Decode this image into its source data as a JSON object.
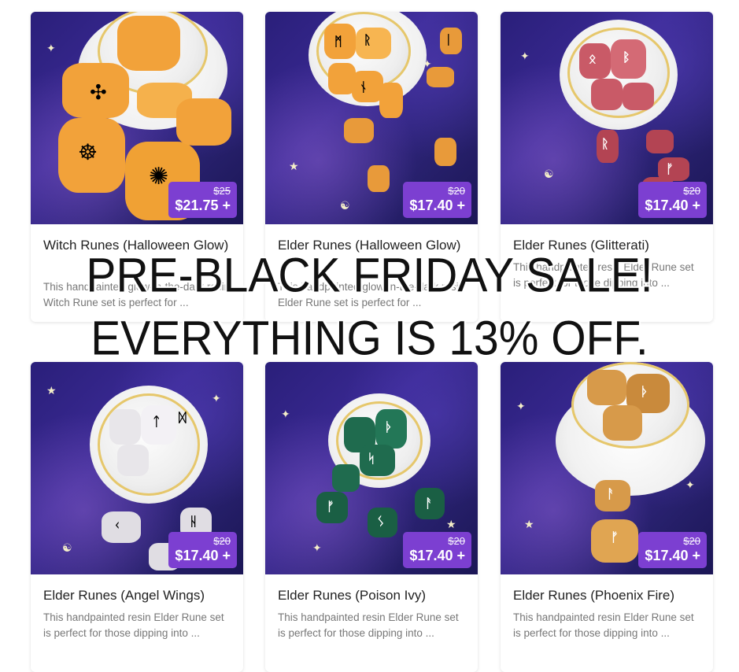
{
  "products": [
    {
      "title": "Witch Runes (Halloween Glow)",
      "desc": "This handpainted glow-in-the-dark resin Witch Rune set is perfect for ...",
      "old_price": "$25",
      "new_price": "$21.75 +",
      "stone_color": "#f2a23a"
    },
    {
      "title": "Elder Runes (Halloween Glow)",
      "desc": "This handpainted glow-in-the-dark resin Elder Rune set is perfect for ...",
      "old_price": "$20",
      "new_price": "$17.40 +",
      "stone_color": "#f2a23a"
    },
    {
      "title": "Elder Runes (Glitterati)",
      "desc": "This handpainted resin Elder Rune set is perfect for those dipping into ...",
      "old_price": "$20",
      "new_price": "$17.40 +",
      "stone_color": "#c95a67"
    },
    {
      "title": "Elder Runes (Angel Wings)",
      "desc": "This handpainted resin Elder Rune set is perfect for those dipping into ...",
      "old_price": "$20",
      "new_price": "$17.40 +",
      "stone_color": "#e8e6ea"
    },
    {
      "title": "Elder Runes (Poison Ivy)",
      "desc": "This handpainted resin Elder Rune set is perfect for those dipping into ...",
      "old_price": "$20",
      "new_price": "$17.40 +",
      "stone_color": "#1f6b4e"
    },
    {
      "title": "Elder Runes (Phoenix Fire)",
      "desc": "This handpainted resin Elder Rune set is perfect for those dipping into ...",
      "old_price": "$20",
      "new_price": "$17.40 +",
      "stone_color": "#d79a4a"
    }
  ],
  "banner": {
    "line1": "PRE-BLACK FRIDAY SALE!",
    "line2": "EVERYTHING IS 13% OFF."
  },
  "colors": {
    "price_badge": "#7c3fd1",
    "cloth": "#2a1f7a"
  }
}
